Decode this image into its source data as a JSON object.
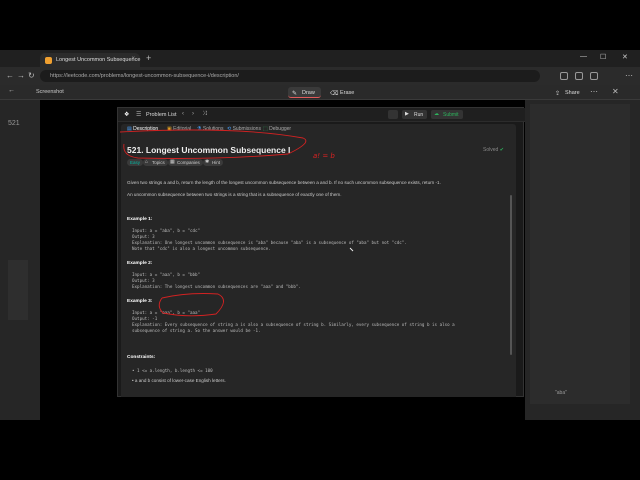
{
  "browser": {
    "tab_title": "Longest Uncommon Subsequence",
    "tab_close": "×",
    "new_tab": "+",
    "url": "https://leetcode.com/problems/longest-uncommon-subsequence-i/description/",
    "win_min": "—",
    "win_max": "☐",
    "win_close": "✕"
  },
  "tool": {
    "title": "Screenshot",
    "draw_label": "Draw",
    "erase_label": "Erase",
    "share_label": "Share"
  },
  "panel": {
    "problem_list": "Problem List",
    "run": "Run",
    "submit": "Submit",
    "tabs": [
      "Description",
      "Editorial",
      "Solutions",
      "Submissions",
      "Debugger"
    ],
    "title": "521. Longest Uncommon Subsequence I",
    "solved": "Solved",
    "chips": [
      "Easy",
      "Topics",
      "Companies",
      "Hint"
    ],
    "desc1": "Given two strings a and b, return the length of the longest uncommon subsequence between a and b. If no such uncommon subsequence exists, return -1.",
    "desc2": "An uncommon subsequence between two strings is a string that is a subsequence of exactly one of them.",
    "ex1_title": "Example 1:",
    "ex1_input": "Input: a = \"aba\", b = \"cdc\"",
    "ex1_output": "Output: 3",
    "ex1_expl": "Explanation: One longest uncommon subsequence is \"aba\" because \"aba\" is a subsequence of \"aba\" but not \"cdc\".",
    "ex1_note": "Note that \"cdc\" is also a longest uncommon subsequence.",
    "ex2_title": "Example 2:",
    "ex2_input": "Input: a = \"aaa\", b = \"bbb\"",
    "ex2_output": "Output: 3",
    "ex2_expl": "Explanation: The longest uncommon subsequences are \"aaa\" and \"bbb\".",
    "ex3_title": "Example 3:",
    "ex3_input": "Input: a = \"aaa\", b = \"aaa\"",
    "ex3_output": "Output: -1",
    "ex3_expl": "Explanation: Every subsequence of string a is also a subsequence of string b. Similarly, every subsequence of string b is also a",
    "ex3_expl2": "subsequence of string a. So the answer would be -1.",
    "constraints_title": "Constraints:",
    "c1": "1 <= a.length, b.length <= 100",
    "c2": "a and b consist of lower-case English letters."
  },
  "annotation": {
    "ink_text": "a! = b"
  },
  "colors": {
    "accent_red": "#d22222",
    "easy": "#00b8a3",
    "link": "#4aa3ff"
  }
}
